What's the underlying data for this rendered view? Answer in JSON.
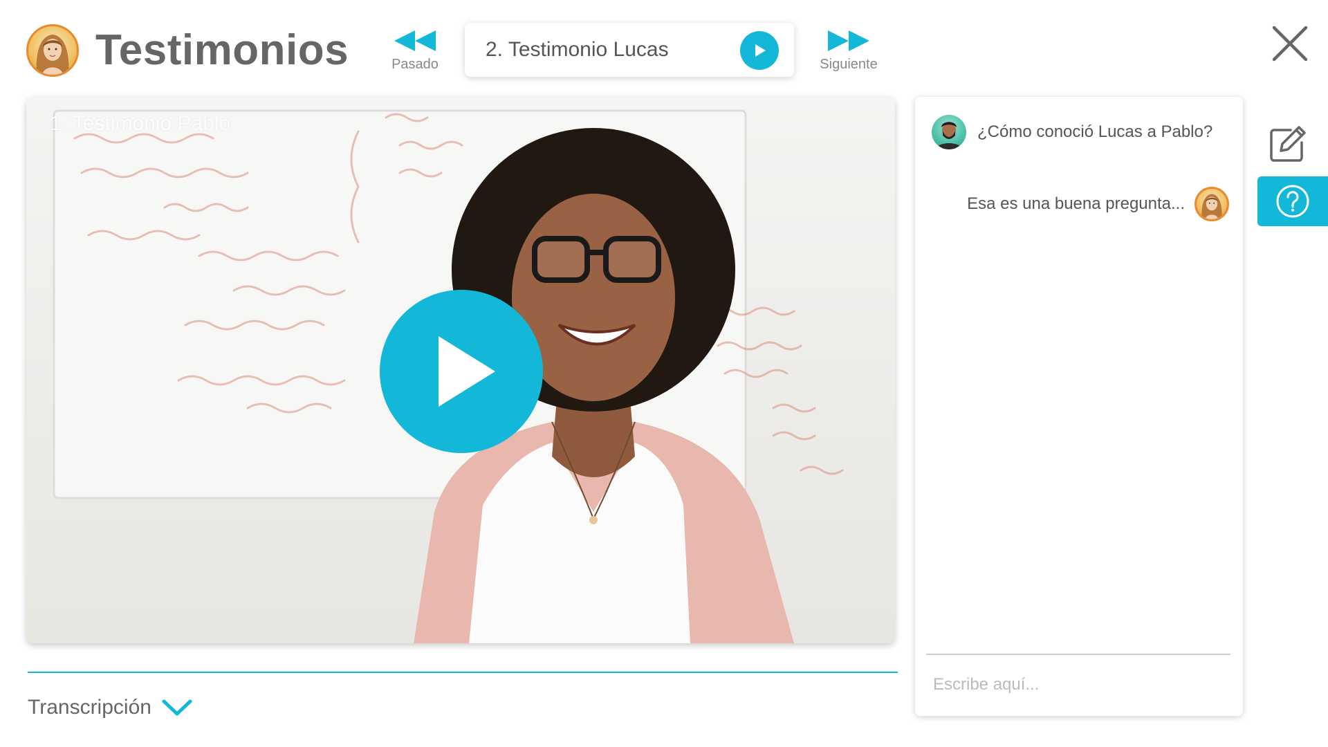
{
  "header": {
    "title": "Testimonios",
    "avatar_icon": "woman-avatar-icon"
  },
  "navigation": {
    "prev_label": "Pasado",
    "next_label": "Siguiente",
    "selected_video": "2. Testimonio Lucas"
  },
  "video": {
    "caption": "1. Testimonio Pablo",
    "play_icon": "play-icon"
  },
  "transcript": {
    "label": "Transcripción",
    "expanded": false
  },
  "chat": {
    "messages": [
      {
        "author": "man-avatar",
        "text": "¿Cómo conoció Lucas a Pablo?"
      },
      {
        "author": "woman-avatar",
        "text": "Esa es una buena pregunta..."
      }
    ],
    "input_placeholder": "Escribe aquí...",
    "input_value": ""
  },
  "tools": {
    "edit_icon": "edit-icon",
    "help_icon": "help-icon",
    "close_icon": "close-icon"
  },
  "colors": {
    "accent": "#13b8d8",
    "title": "#666666",
    "text": "#555555",
    "muted": "#888888"
  }
}
